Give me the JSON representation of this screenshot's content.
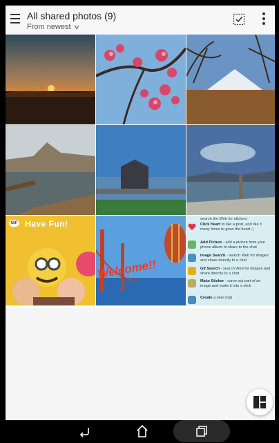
{
  "header": {
    "title": "All shared photos (9)",
    "sort_label": "From newest",
    "icons": {
      "menu": "hamburger-icon",
      "select": "select-all-icon",
      "more": "more-vert-icon"
    }
  },
  "photos": {
    "overlay_gif_badge": "GIF",
    "overlay_have_fun": "Have Fun!",
    "overlay_welcome": "Welcome!!"
  },
  "help_card": {
    "intro": "search the Web for stickers",
    "items": [
      {
        "title": "Click Heart",
        "desc": "to like a post, and like it many times to grow the heart :)"
      },
      {
        "title": "Add Picture",
        "desc": "- add a picture from your phone album to share to the chat"
      },
      {
        "title": "Image Search",
        "desc": "- search Web for images and share directly to a chat"
      },
      {
        "title": "Gif Search",
        "desc": "- search Web for images and share directly to a chat"
      },
      {
        "title": "Make Sticker",
        "desc": "- carve out part of an image and make it into a stick"
      },
      {
        "title": "Create",
        "desc": "a new chat"
      }
    ]
  },
  "fab": {
    "icon": "layout-icon"
  },
  "navbar": {
    "back": "back-icon",
    "home": "home-icon",
    "recents": "recents-icon"
  }
}
